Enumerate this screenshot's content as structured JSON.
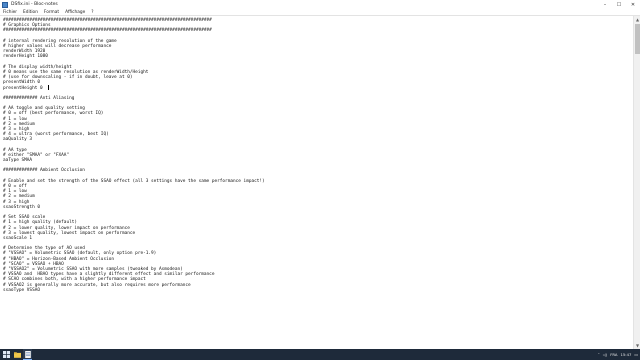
{
  "window": {
    "title": "DSfix.ini - Bloc-notes",
    "minimize": "–",
    "maximize": "☐",
    "close": "✕"
  },
  "menu": [
    "Fichier",
    "Edition",
    "Format",
    "Affichage",
    "?"
  ],
  "editor": {
    "lines": [
      "###############################################################################",
      "# Graphics Options",
      "###############################################################################",
      "",
      "# internal rendering resolution of the game",
      "# higher values will decrease performance",
      "renderWidth 1920",
      "renderHeight 1080",
      "",
      "# The display width/height",
      "# 0 means use the same resolution as renderWidth/Height",
      "# (use for downscaling - if in doubt, leave at 0)",
      "presentWidth 0",
      "presentHeight 0",
      "",
      "############# Anti Aliasing",
      "",
      "# AA toggle and quality setting",
      "# 0 = off (best performance, worst IQ)",
      "# 1 = low",
      "# 2 = medium",
      "# 3 = high",
      "# 4 = ultra (worst performance, best IQ)",
      "aaQuality 3",
      "",
      "# AA type",
      "# either \"SMAA\" or \"FXAA\"",
      "aaType SMAA",
      "",
      "############# Ambient Occlusion",
      "",
      "# Enable and set the strength of the SSAO effect (all 3 settings have the same performance impact!)",
      "# 0 = off",
      "# 1 = low",
      "# 2 = medium",
      "# 3 = high",
      "ssaoStrength 0",
      "",
      "# Set SSAO scale",
      "# 1 = high quality (default)",
      "# 2 = lower quality, lower impact on performance",
      "# 3 = lowest quality, lowest impact on performance",
      "ssaoScale 1",
      "",
      "# Determine the type of AO used",
      "# \"VSSAO\" = Volumetric SSAO (default, only option pre-1.9)",
      "# \"HBAO\" = Horizon-Based Ambient Occlusion",
      "# \"SCAO\" = VSSAO + HBAO",
      "# \"VSSAO2\" = Volumetric SSAO with more samples (tweaked by Asmodean)",
      "# VSSAO and  HBAO types have a slightly different effect and similar performance",
      "# SCAO combines both, with a higher performance impact",
      "# VSSAO2 is generally more accurate, but also requires more performance",
      "ssaoType VSSAO",
      "",
      "",
      "",
      "",
      "",
      "",
      "",
      "",
      "",
      ""
    ]
  },
  "taskbar": {
    "lang": "FRA",
    "time": "15:47"
  }
}
